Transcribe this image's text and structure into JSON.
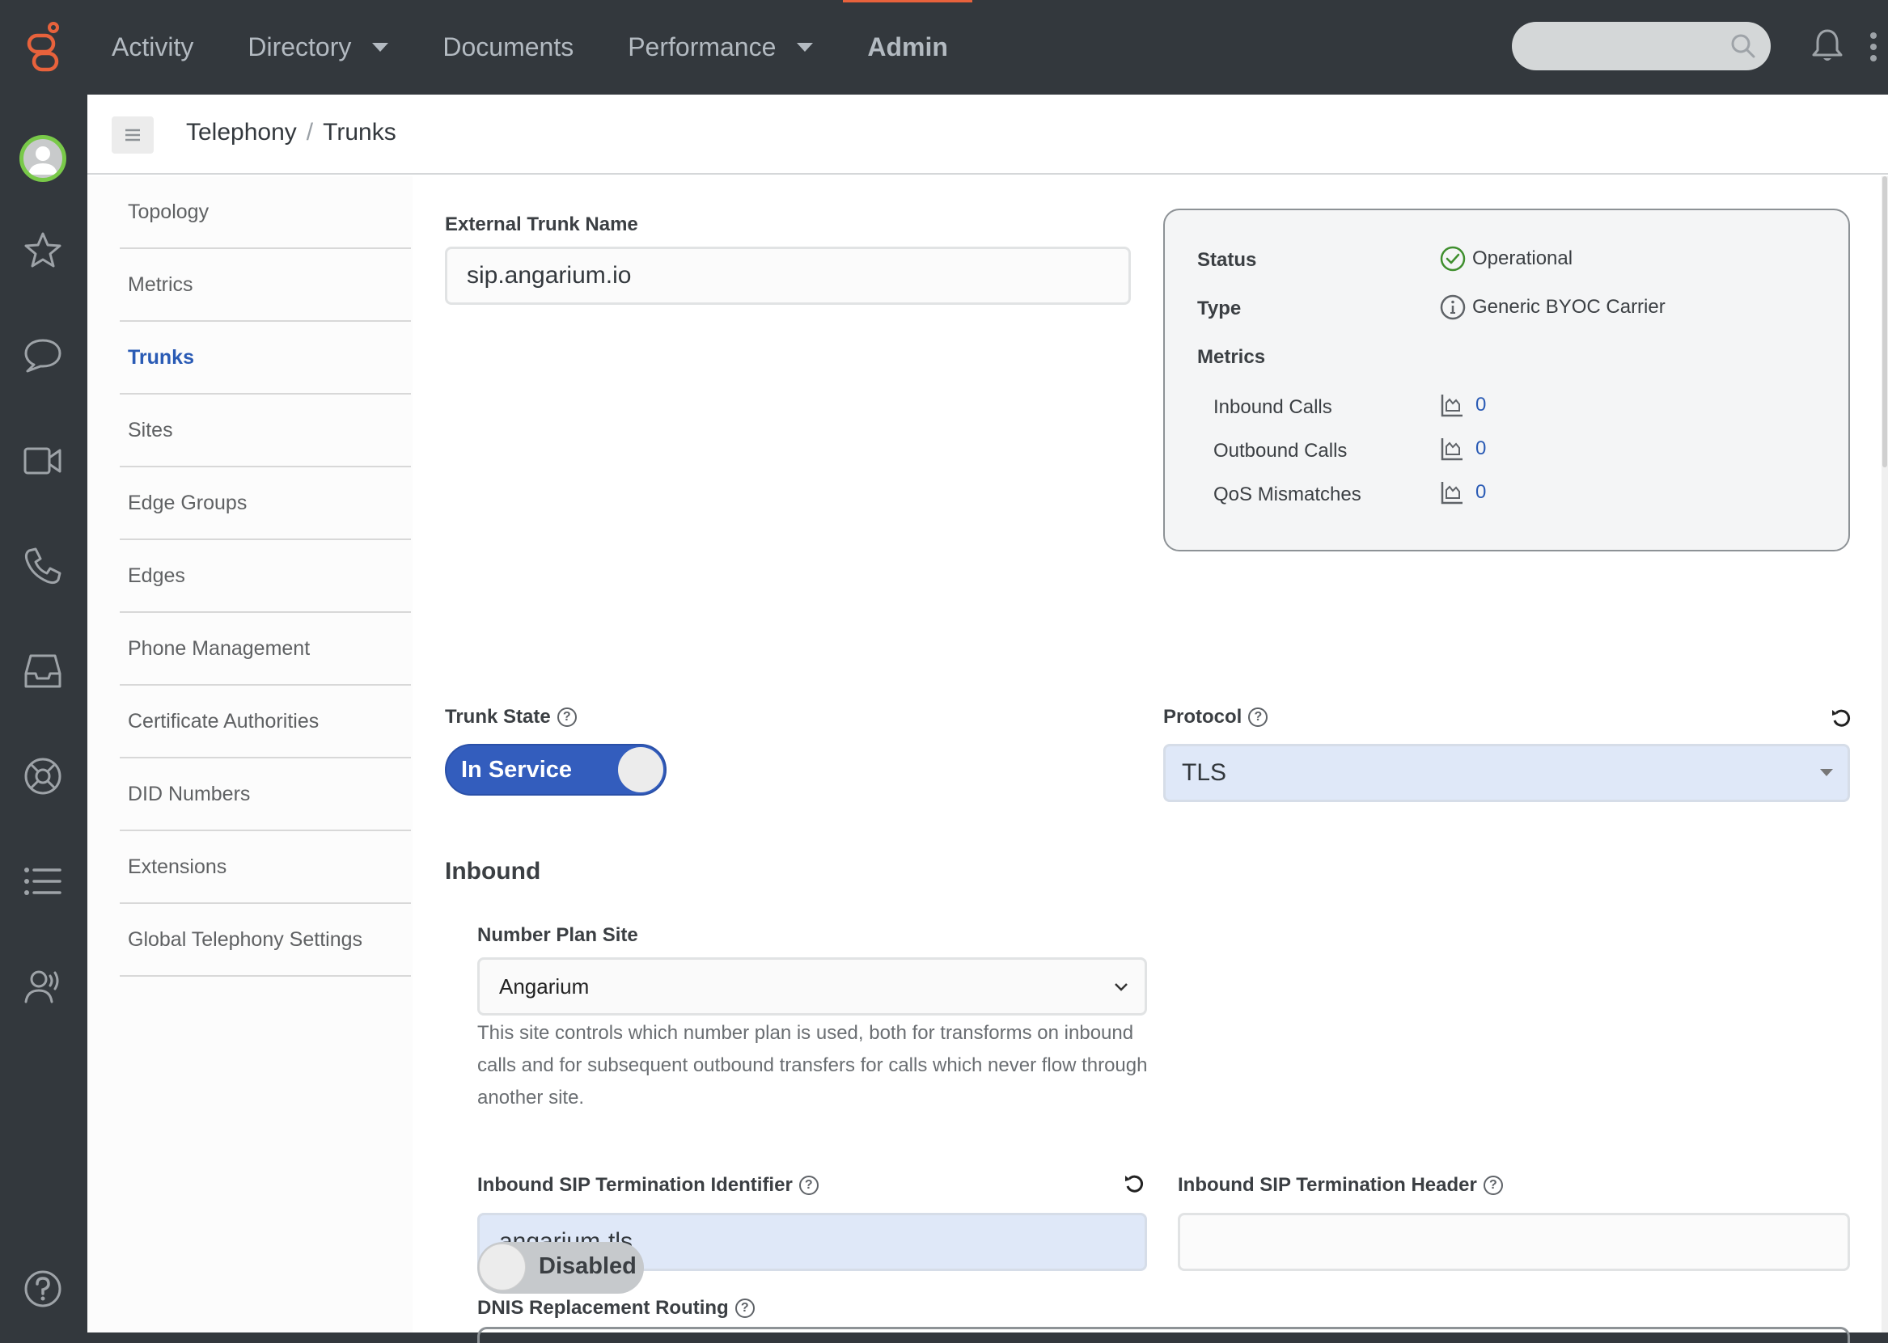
{
  "topnav": {
    "items": [
      {
        "label": "Activity",
        "dropdown": false,
        "active": false
      },
      {
        "label": "Directory",
        "dropdown": true,
        "active": false
      },
      {
        "label": "Documents",
        "dropdown": false,
        "active": false
      },
      {
        "label": "Performance",
        "dropdown": true,
        "active": false
      },
      {
        "label": "Admin",
        "dropdown": false,
        "active": true
      }
    ],
    "search_placeholder": "",
    "accent_color": "#e8623c"
  },
  "rail": {
    "icons": [
      "avatar",
      "star-icon",
      "chat-icon",
      "video-icon",
      "phone-icon",
      "inbox-icon",
      "lifebuoy-icon",
      "list-icon",
      "agent-voice-icon",
      "help-icon"
    ]
  },
  "breadcrumb": {
    "parent": "Telephony",
    "separator": "/",
    "current": "Trunks"
  },
  "subnav": {
    "items": [
      {
        "label": "Topology",
        "active": false
      },
      {
        "label": "Metrics",
        "active": false
      },
      {
        "label": "Trunks",
        "active": true
      },
      {
        "label": "Sites",
        "active": false
      },
      {
        "label": "Edge Groups",
        "active": false
      },
      {
        "label": "Edges",
        "active": false
      },
      {
        "label": "Phone Management",
        "active": false
      },
      {
        "label": "Certificate Authorities",
        "active": false
      },
      {
        "label": "DID Numbers",
        "active": false
      },
      {
        "label": "Extensions",
        "active": false
      },
      {
        "label": "Global Telephony Settings",
        "active": false
      }
    ]
  },
  "form": {
    "external_trunk_name": {
      "label": "External Trunk Name",
      "value": "sip.angarium.io"
    },
    "trunk_state": {
      "label": "Trunk State",
      "value": "In Service",
      "enabled": true
    },
    "protocol": {
      "label": "Protocol",
      "value": "TLS"
    },
    "inbound": {
      "section_title": "Inbound",
      "number_plan_site": {
        "label": "Number Plan Site",
        "value": "Angarium",
        "description": "This site controls which number plan is used, both for transforms on inbound calls and for subsequent outbound transfers for calls which never flow through another site."
      },
      "sip_termination_identifier": {
        "label": "Inbound SIP Termination Identifier",
        "value": "angarium-tls"
      },
      "sip_termination_header": {
        "label": "Inbound SIP Termination Header",
        "value": ""
      },
      "dnis_replacement_routing": {
        "label": "DNIS Replacement Routing",
        "value": "Disabled",
        "enabled": false
      }
    }
  },
  "info_card": {
    "status_label": "Status",
    "status_value": "Operational",
    "status_color": "#3f8f2e",
    "type_label": "Type",
    "type_value": "Generic BYOC Carrier",
    "metrics_label": "Metrics",
    "metrics": [
      {
        "label": "Inbound Calls",
        "value": "0"
      },
      {
        "label": "Outbound Calls",
        "value": "0"
      },
      {
        "label": "QoS Mismatches",
        "value": "0"
      }
    ]
  }
}
